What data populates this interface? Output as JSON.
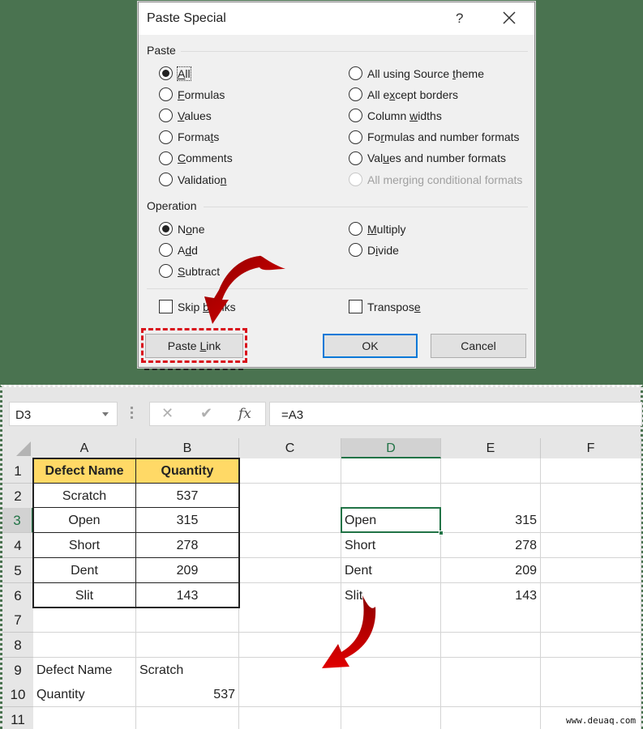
{
  "dialog": {
    "title": "Paste Special",
    "help_label": "?",
    "paste_group_label": "Paste",
    "paste_options_left": [
      {
        "label": "All",
        "underline_index": 0,
        "selected": true
      },
      {
        "label": "Formulas",
        "underline_index": 0,
        "selected": false
      },
      {
        "label": "Values",
        "underline_index": 0,
        "selected": false
      },
      {
        "label": "Formats",
        "underline_index": 5,
        "selected": false
      },
      {
        "label": "Comments",
        "underline_index": 0,
        "selected": false
      },
      {
        "label": "Validation",
        "underline_index": 9,
        "selected": false
      }
    ],
    "paste_options_right": [
      {
        "label": "All using Source theme",
        "underline_index": 17,
        "selected": false,
        "disabled": false
      },
      {
        "label": "All except borders",
        "underline_index": 5,
        "selected": false,
        "disabled": false
      },
      {
        "label": "Column widths",
        "underline_index": 7,
        "selected": false,
        "disabled": false
      },
      {
        "label": "Formulas and number formats",
        "underline_index": 2,
        "selected": false,
        "disabled": false
      },
      {
        "label": "Values and number formats",
        "underline_index": 3,
        "selected": false,
        "disabled": false
      },
      {
        "label": "All merging conditional formats",
        "underline_index": -1,
        "selected": false,
        "disabled": true
      }
    ],
    "operation_group_label": "Operation",
    "operation_options_left": [
      {
        "label": "None",
        "underline_index": 1,
        "selected": true
      },
      {
        "label": "Add",
        "underline_index": 1,
        "selected": false
      },
      {
        "label": "Subtract",
        "underline_index": 0,
        "selected": false
      }
    ],
    "operation_options_right": [
      {
        "label": "Multiply",
        "underline_index": 0,
        "selected": false
      },
      {
        "label": "Divide",
        "underline_index": 1,
        "selected": false
      }
    ],
    "skip_blanks": {
      "label": "Skip blanks",
      "underline_index": 5,
      "checked": false
    },
    "transpose": {
      "label": "Transpose",
      "underline_index": 8,
      "checked": false
    },
    "paste_link_label": "Paste Link",
    "ok_label": "OK",
    "cancel_label": "Cancel"
  },
  "excel": {
    "name_box": "D3",
    "formula": "=A3",
    "columns": [
      "A",
      "B",
      "C",
      "D",
      "E",
      "F"
    ],
    "selected_column": "D",
    "rows": [
      "1",
      "2",
      "3",
      "4",
      "5",
      "6",
      "7",
      "8",
      "9",
      "10",
      "11"
    ],
    "selected_row": "3",
    "table": {
      "headers": [
        "Defect Name",
        "Quantity"
      ],
      "rows": [
        [
          "Scratch",
          "537"
        ],
        [
          "Open",
          "315"
        ],
        [
          "Short",
          "278"
        ],
        [
          "Dent",
          "209"
        ],
        [
          "Slit",
          "143"
        ]
      ]
    },
    "linked": [
      [
        "Open",
        "315"
      ],
      [
        "Short",
        "278"
      ],
      [
        "Dent",
        "209"
      ],
      [
        "Slit",
        "143"
      ]
    ],
    "transposed": [
      [
        "Defect Name",
        "Scratch"
      ],
      [
        "Quantity",
        "537"
      ]
    ]
  },
  "watermark": "www.deuaq.com",
  "colors": {
    "background": "#4a7350",
    "header_fill": "#ffd966",
    "excel_green": "#217346",
    "highlight_red": "#d9111b",
    "dialog_default_blue": "#0078d7"
  }
}
